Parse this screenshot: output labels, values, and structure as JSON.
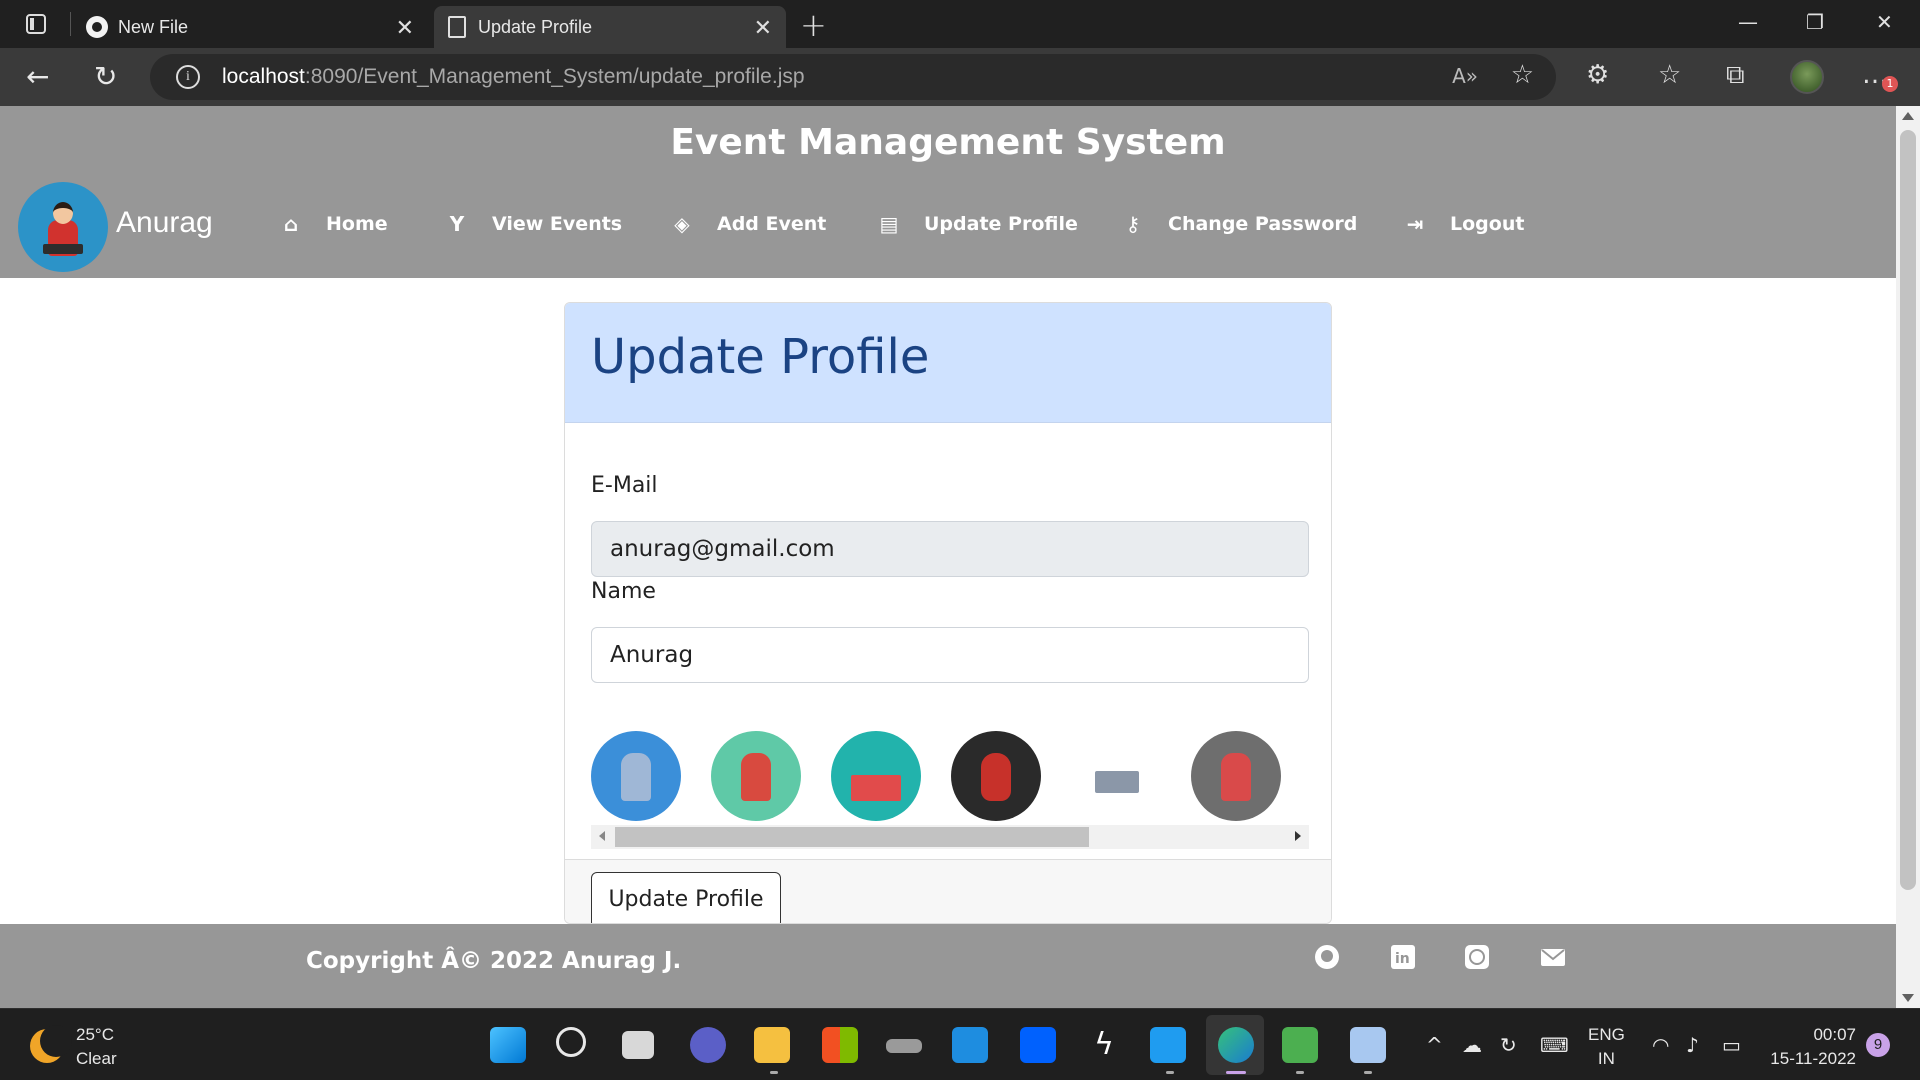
{
  "browser": {
    "tabs": [
      {
        "label": "New File",
        "icon": "github-icon"
      },
      {
        "label": "Update Profile",
        "icon": "page-icon",
        "active": true
      }
    ],
    "url_host": "localhost",
    "url_path": ":8090/Event_Management_System/update_profile.jsp",
    "extension_badge": "1"
  },
  "site": {
    "title": "Event Management System",
    "user_name": "Anurag",
    "nav": [
      {
        "label": "Home",
        "icon": "home-icon"
      },
      {
        "label": "View Events",
        "icon": "cocktail-icon"
      },
      {
        "label": "Add Event",
        "icon": "gamepad-icon"
      },
      {
        "label": "Update Profile",
        "icon": "id-card-icon"
      },
      {
        "label": "Change Password",
        "icon": "key-icon"
      },
      {
        "label": "Logout",
        "icon": "logout-icon"
      }
    ]
  },
  "form": {
    "heading": "Update Profile",
    "email_label": "E-Mail",
    "email_value": "anurag@gmail.com",
    "name_label": "Name",
    "name_value": "Anurag",
    "avatar_options": [
      {
        "name": "avatar-thinking-man",
        "bg": "#3b8fd9"
      },
      {
        "name": "avatar-guitarist",
        "bg": "#5fc9a7"
      },
      {
        "name": "avatar-desk-lamp",
        "bg": "#22b3ac"
      },
      {
        "name": "avatar-iron-man",
        "bg": "#2a2a2a"
      },
      {
        "name": "avatar-office-worker",
        "bg": "#ffffff"
      },
      {
        "name": "avatar-woman-desk",
        "bg": "#6e6e6e"
      },
      {
        "name": "avatar-red-partial",
        "bg": "#e53b3b"
      }
    ],
    "submit_label": "Update Profile"
  },
  "footer": {
    "copyright": "Copyright Â© 2022 Anurag J.",
    "social": [
      "github-icon",
      "linkedin-icon",
      "whatsapp-icon",
      "mail-icon"
    ]
  },
  "taskbar": {
    "temperature": "25°C",
    "condition": "Clear",
    "lang_top": "ENG",
    "lang_bottom": "IN",
    "time": "00:07",
    "date": "15-11-2022",
    "notification_count": "9"
  }
}
